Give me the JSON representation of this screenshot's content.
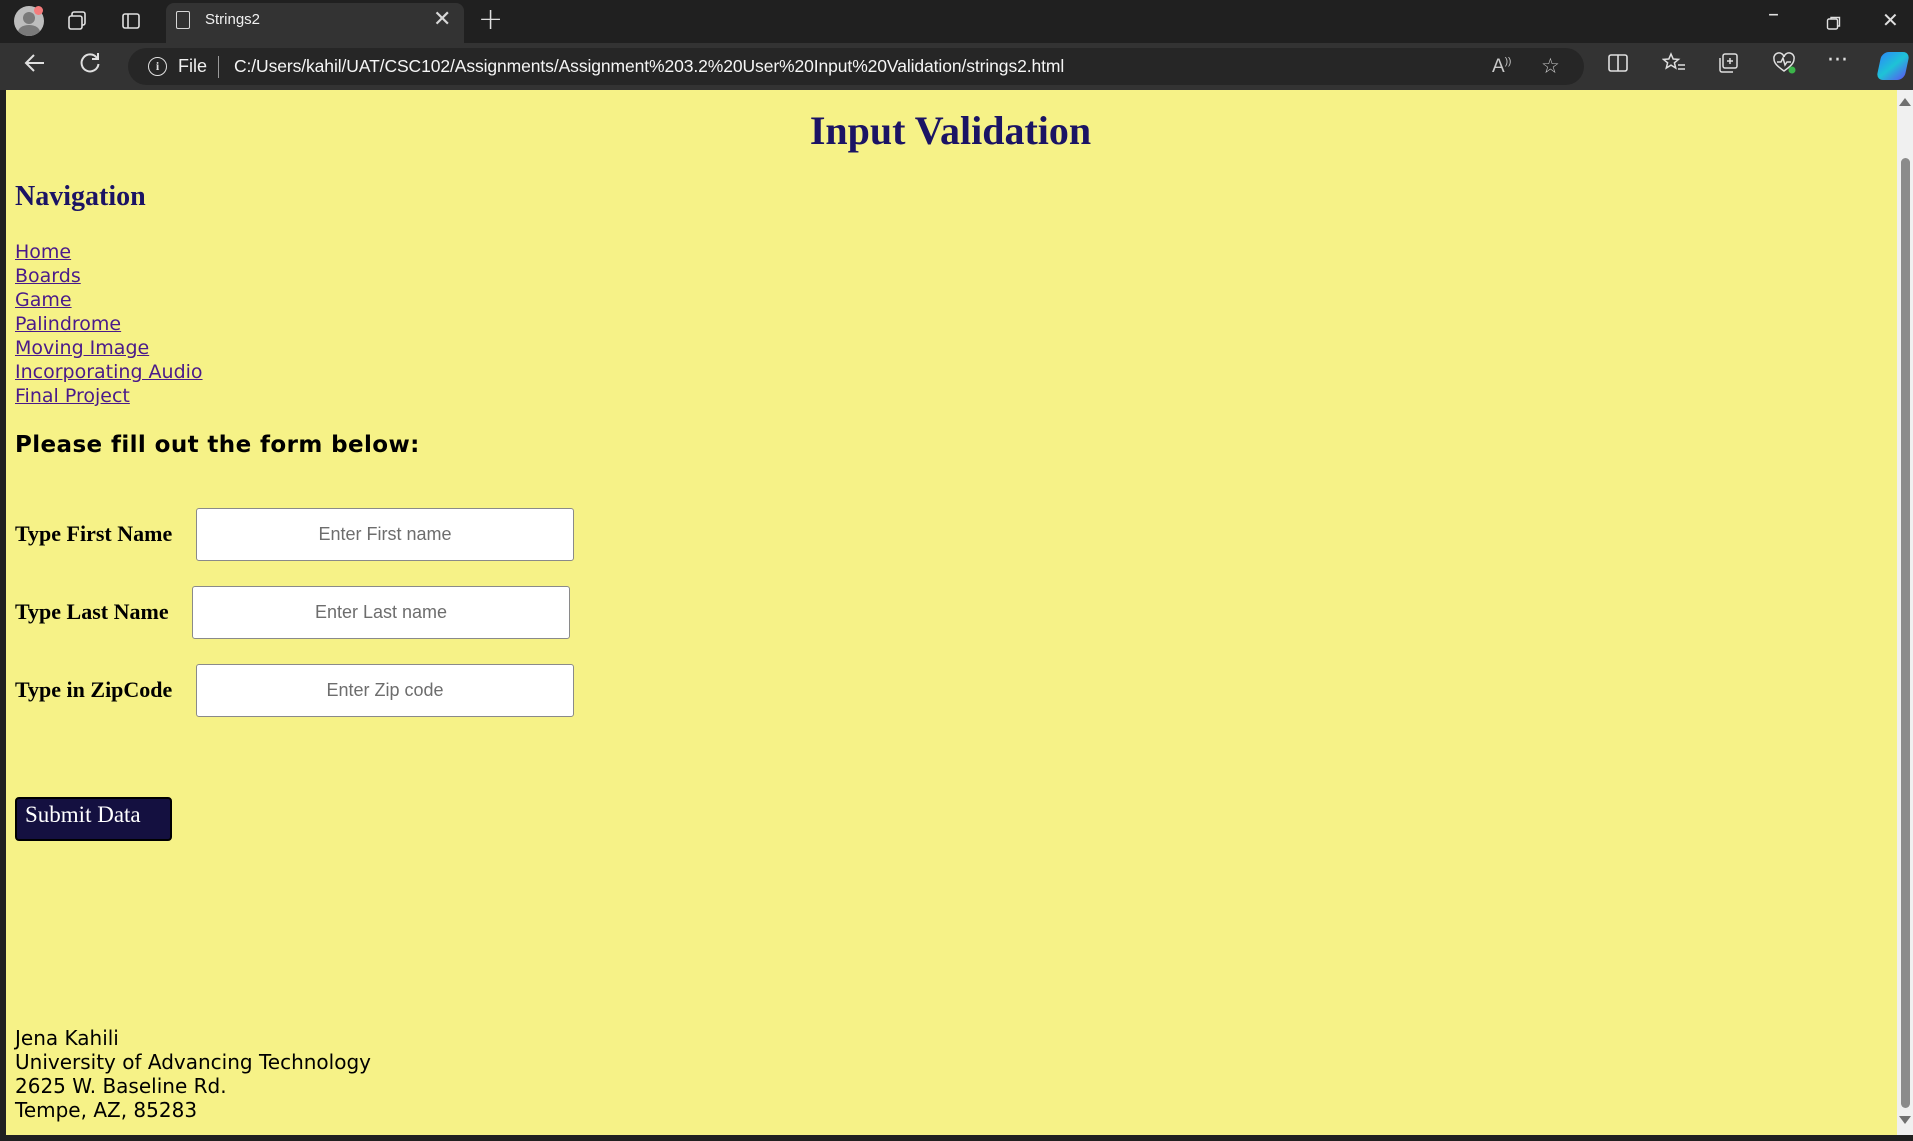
{
  "browser": {
    "tab_title": "Strings2",
    "tab_close": "✕",
    "new_tab": "+",
    "address_prefix": "File",
    "url": "C:/Users/kahil/UAT/CSC102/Assignments/Assignment%203.2%20User%20Input%20Validation/strings2.html",
    "icons": [
      "profile-icon",
      "workspaces-icon",
      "tab-actions-icon",
      "page-icon",
      "back-icon",
      "refresh-icon",
      "info-icon",
      "read-aloud-icon",
      "favorite-star-icon",
      "split-screen-icon",
      "favorites-icon",
      "collections-icon",
      "browser-essentials-icon",
      "more-icon",
      "copilot-icon",
      "minimize-icon",
      "restore-icon",
      "close-icon"
    ]
  },
  "page": {
    "title": "Input Validation",
    "nav_heading": "Navigation",
    "nav_links": [
      "Home",
      "Boards",
      "Game",
      "Palindrome",
      "Moving Image",
      "Incorporating Audio",
      "Final Project"
    ],
    "form_intro": "Please fill out the form below:",
    "fields": {
      "first_name": {
        "label": "Type First Name",
        "placeholder": "Enter First name",
        "value": ""
      },
      "last_name": {
        "label": "Type Last Name",
        "placeholder": "Enter Last name",
        "value": ""
      },
      "zip": {
        "label": "Type in ZipCode",
        "placeholder": "Enter Zip code",
        "value": ""
      }
    },
    "submit_label": "Submit Data",
    "footer": {
      "name": "Jena Kahili",
      "org": "University of Advancing Technology",
      "street": "2625 W. Baseline Rd.",
      "city": "Tempe, AZ, 85283"
    }
  },
  "colors": {
    "page_background": "#f6f287",
    "heading": "#1b1464",
    "link": "#4a1a8a",
    "button": "#141040"
  }
}
